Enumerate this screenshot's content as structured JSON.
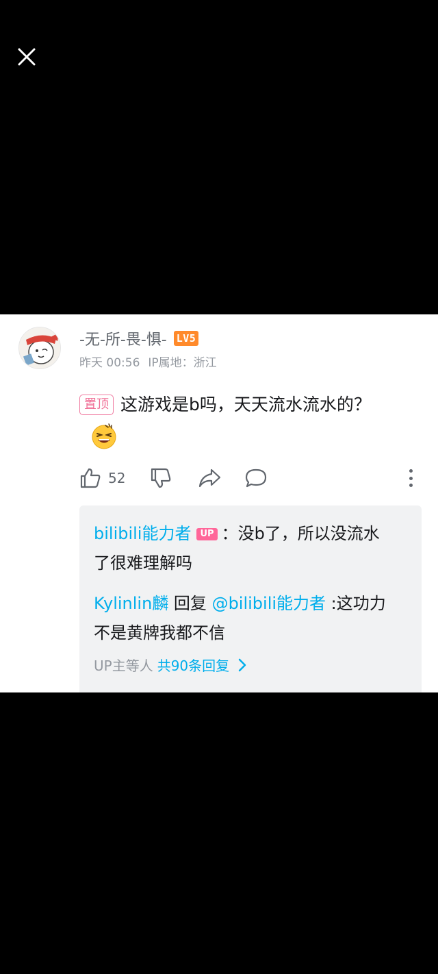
{
  "comment": {
    "username": "-无-所-畏-惧-",
    "level": "LV5",
    "time": "昨天 00:56",
    "ip": "IP属地：浙江",
    "pin_label": "置顶",
    "text": "这游戏是b吗，天天流水流水的？",
    "likes": "52"
  },
  "replies": [
    {
      "author": "bilibili能力者",
      "badge": "UP",
      "separator": "：",
      "text": "没b了，所以没流水了很难理解吗"
    },
    {
      "author": "Kylinlin麟",
      "reply_word": " 回复 ",
      "mention": "@bilibili能力者",
      "separator": " :",
      "text": "这功力不是黄牌我都不信"
    }
  ],
  "summary": {
    "prefix": "UP主等人",
    "count": "共90条回复"
  },
  "colors": {
    "accent_blue": "#00aeec",
    "pin_pink": "#f06e95",
    "level_orange": "#ff8a2b"
  },
  "icons": [
    "close-icon",
    "thumbs-up-icon",
    "thumbs-down-icon",
    "share-icon",
    "comment-icon",
    "more-icon",
    "chevron-right-icon",
    "grin-emoji-icon"
  ]
}
